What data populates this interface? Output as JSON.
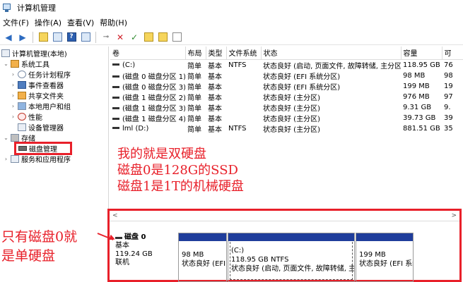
{
  "window": {
    "title": "计算机管理"
  },
  "menu": [
    "文件(F)",
    "操作(A)",
    "查看(V)",
    "帮助(H)"
  ],
  "toolbar": {
    "back": "◀",
    "forward": "▶",
    "help": "?",
    "delete": "✕",
    "check": "✓"
  },
  "tree": {
    "root": "计算机管理(本地)",
    "system_tools": "系统工具",
    "task_scheduler": "任务计划程序",
    "event_viewer": "事件查看器",
    "shared_folders": "共享文件夹",
    "local_users": "本地用户和组",
    "performance": "性能",
    "device_manager": "设备管理器",
    "storage": "存储",
    "disk_management": "磁盘管理",
    "services": "服务和应用程序"
  },
  "table": {
    "columns": [
      "卷",
      "布局",
      "类型",
      "文件系统",
      "状态",
      "容量",
      "可"
    ],
    "rows": [
      [
        "(C:)",
        "简单",
        "基本",
        "NTFS",
        "状态良好 (启动, 页面文件, 故障转储, 主分区)",
        "118.95 GB",
        "76"
      ],
      [
        "(磁盘 0 磁盘分区 1)",
        "简单",
        "基本",
        "",
        "状态良好 (EFI 系统分区)",
        "98 MB",
        "98"
      ],
      [
        "(磁盘 0 磁盘分区 3)",
        "简单",
        "基本",
        "",
        "状态良好 (EFI 系统分区)",
        "199 MB",
        "19"
      ],
      [
        "(磁盘 1 磁盘分区 2)",
        "简单",
        "基本",
        "",
        "状态良好 (主分区)",
        "976 MB",
        "97"
      ],
      [
        "(磁盘 1 磁盘分区 3)",
        "简单",
        "基本",
        "",
        "状态良好 (主分区)",
        "9.31 GB",
        "9."
      ],
      [
        "(磁盘 1 磁盘分区 4)",
        "简单",
        "基本",
        "",
        "状态良好 (主分区)",
        "39.73 GB",
        "39"
      ],
      [
        "lml (D:)",
        "简单",
        "基本",
        "NTFS",
        "状态良好 (主分区)",
        "881.51 GB",
        "35"
      ]
    ]
  },
  "annotations": {
    "line1": "我的就是双硬盘",
    "line2": "磁盘0是128G的SSD",
    "line3": "磁盘1是1T的机械硬盘",
    "side1": "只有磁盘0就",
    "side2": "是单硬盘"
  },
  "diskmap": {
    "scroll_left": "<",
    "scroll_right": ">",
    "disk": {
      "name": "磁盘 0",
      "type": "基本",
      "size": "119.24 GB",
      "status": "联机"
    },
    "partitions": [
      {
        "name": "",
        "size": "98 MB",
        "status": "状态良好 (EFI"
      },
      {
        "name": "(C:)",
        "size": "118.95 GB NTFS",
        "status": "状态良好 (启动, 页面文件, 故障转储, 主"
      },
      {
        "name": "",
        "size": "199 MB",
        "status": "状态良好 (EFI 系统"
      }
    ]
  },
  "colors": {
    "accent_red": "#e8202a",
    "partition_bar": "#1f3d9b"
  }
}
